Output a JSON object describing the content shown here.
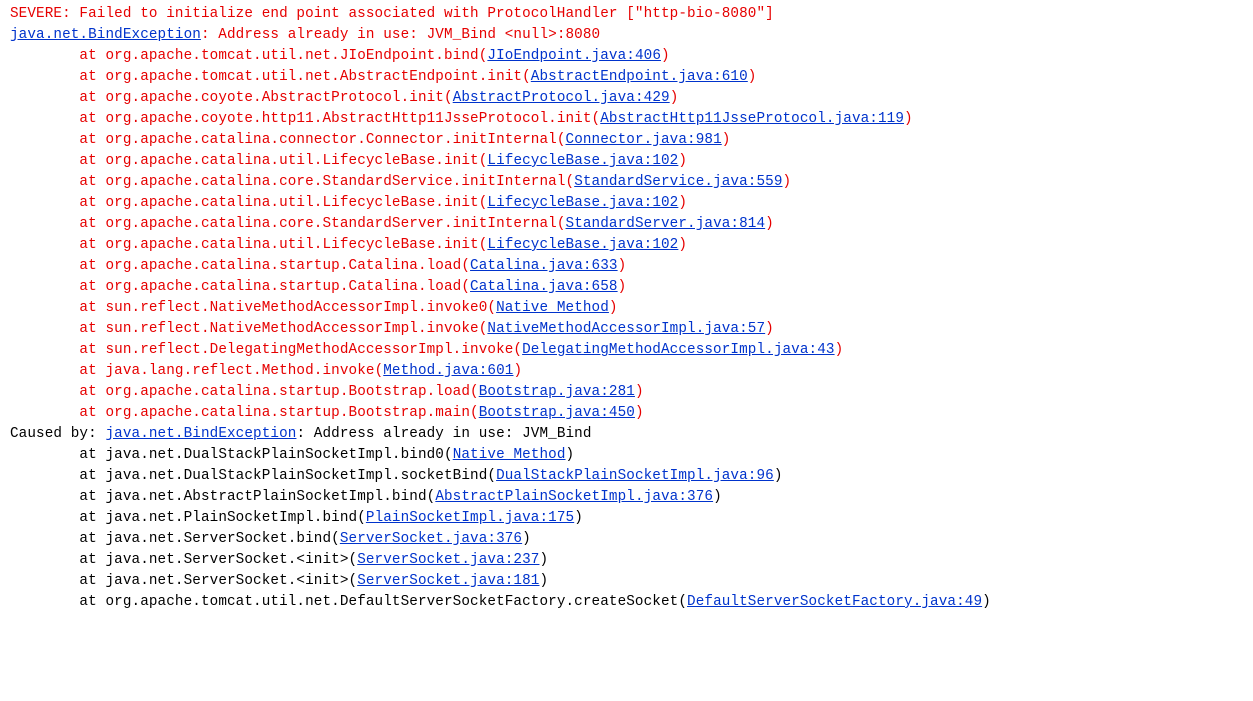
{
  "severe_line": "SEVERE: Failed to initialize end point associated with ProtocolHandler [\"http-bio-8080\"]",
  "top_exception": {
    "class": "java.net.BindException",
    "message": ": Address already in use: JVM_Bind <null>:8080"
  },
  "indent_at": "        at ",
  "red_frames": [
    {
      "call": "org.apache.tomcat.util.net.JIoEndpoint.bind",
      "src": "JIoEndpoint.java:406"
    },
    {
      "call": "org.apache.tomcat.util.net.AbstractEndpoint.init",
      "src": "AbstractEndpoint.java:610"
    },
    {
      "call": "org.apache.coyote.AbstractProtocol.init",
      "src": "AbstractProtocol.java:429"
    },
    {
      "call": "org.apache.coyote.http11.AbstractHttp11JsseProtocol.init",
      "src": "AbstractHttp11JsseProtocol.java:119"
    },
    {
      "call": "org.apache.catalina.connector.Connector.initInternal",
      "src": "Connector.java:981"
    },
    {
      "call": "org.apache.catalina.util.LifecycleBase.init",
      "src": "LifecycleBase.java:102"
    },
    {
      "call": "org.apache.catalina.core.StandardService.initInternal",
      "src": "StandardService.java:559"
    },
    {
      "call": "org.apache.catalina.util.LifecycleBase.init",
      "src": "LifecycleBase.java:102"
    },
    {
      "call": "org.apache.catalina.core.StandardServer.initInternal",
      "src": "StandardServer.java:814"
    },
    {
      "call": "org.apache.catalina.util.LifecycleBase.init",
      "src": "LifecycleBase.java:102"
    },
    {
      "call": "org.apache.catalina.startup.Catalina.load",
      "src": "Catalina.java:633"
    },
    {
      "call": "org.apache.catalina.startup.Catalina.load",
      "src": "Catalina.java:658"
    },
    {
      "call": "sun.reflect.NativeMethodAccessorImpl.invoke0",
      "src": "Native Method"
    },
    {
      "call": "sun.reflect.NativeMethodAccessorImpl.invoke",
      "src": "NativeMethodAccessorImpl.java:57"
    },
    {
      "call": "sun.reflect.DelegatingMethodAccessorImpl.invoke",
      "src": "DelegatingMethodAccessorImpl.java:43"
    },
    {
      "call": "java.lang.reflect.Method.invoke",
      "src": "Method.java:601"
    },
    {
      "call": "org.apache.catalina.startup.Bootstrap.load",
      "src": "Bootstrap.java:281"
    },
    {
      "call": "org.apache.catalina.startup.Bootstrap.main",
      "src": "Bootstrap.java:450"
    }
  ],
  "caused_by": {
    "prefix": "Caused by: ",
    "class": "java.net.BindException",
    "message": ": Address already in use: JVM_Bind"
  },
  "black_frames": [
    {
      "call": "java.net.DualStackPlainSocketImpl.bind0",
      "src": "Native Method"
    },
    {
      "call": "java.net.DualStackPlainSocketImpl.socketBind",
      "src": "DualStackPlainSocketImpl.java:96"
    },
    {
      "call": "java.net.AbstractPlainSocketImpl.bind",
      "src": "AbstractPlainSocketImpl.java:376"
    },
    {
      "call": "java.net.PlainSocketImpl.bind",
      "src": "PlainSocketImpl.java:175"
    },
    {
      "call": "java.net.ServerSocket.bind",
      "src": "ServerSocket.java:376"
    },
    {
      "call": "java.net.ServerSocket.<init>",
      "src": "ServerSocket.java:237"
    },
    {
      "call": "java.net.ServerSocket.<init>",
      "src": "ServerSocket.java:181"
    },
    {
      "call": "org.apache.tomcat.util.net.DefaultServerSocketFactory.createSocket",
      "src": "DefaultServerSocketFactory.java:49"
    }
  ]
}
